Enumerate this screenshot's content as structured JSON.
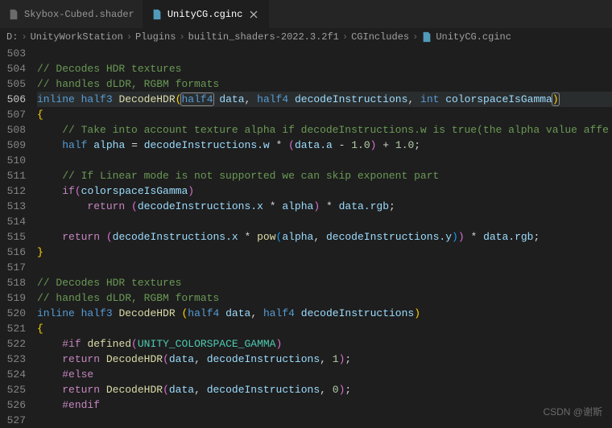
{
  "tabs": [
    {
      "label": "Skybox-Cubed.shader",
      "active": false
    },
    {
      "label": "UnityCG.cginc",
      "active": true
    }
  ],
  "breadcrumbs": [
    {
      "text": "D:"
    },
    {
      "text": "UnityWorkStation"
    },
    {
      "text": "Plugins"
    },
    {
      "text": "builtin_shaders-2022.3.2f1"
    },
    {
      "text": "CGIncludes"
    },
    {
      "text": "UnityCG.cginc"
    }
  ],
  "line_start": 503,
  "line_end": 527,
  "highlighted_line": 506,
  "code": {
    "l503": "",
    "l504": "// Decodes HDR textures",
    "l505": "// handles dLDR, RGBM formats",
    "l506_kw": "inline",
    "l506_type1": "half3",
    "l506_fn": "DecodeHDR",
    "l506_type2": "half4",
    "l506_p1": "data",
    "l506_type3": "half4",
    "l506_p2": "decodeInstructions",
    "l506_type4": "int",
    "l506_p3": "colorspaceIsGamma",
    "l508": "// Take into account texture alpha if decodeInstructions.w is true(the alpha value affe",
    "l509_type": "half",
    "l509_var": "alpha",
    "l509_expr1": "decodeInstructions.w",
    "l509_expr2": "data.a",
    "l509_n1": "1.0",
    "l509_n2": "1.0",
    "l511": "// If Linear mode is not supported we can skip exponent part",
    "l512_kw": "if",
    "l512_cond": "colorspaceIsGamma",
    "l513_kw": "return",
    "l513_a": "decodeInstructions.x",
    "l513_b": "alpha",
    "l513_c": "data.rgb",
    "l515_kw": "return",
    "l515_a": "decodeInstructions.x",
    "l515_fn": "pow",
    "l515_b": "alpha",
    "l515_c": "decodeInstructions.y",
    "l515_d": "data.rgb",
    "l518": "// Decodes HDR textures",
    "l519": "// handles dLDR, RGBM formats",
    "l520_kw": "inline",
    "l520_type1": "half3",
    "l520_fn": "DecodeHDR",
    "l520_type2": "half4",
    "l520_p1": "data",
    "l520_type3": "half4",
    "l520_p2": "decodeInstructions",
    "l522_if": "#if",
    "l522_def": "defined",
    "l522_sym": "UNITY_COLORSPACE_GAMMA",
    "l523_kw": "return",
    "l523_fn": "DecodeHDR",
    "l523_a": "data",
    "l523_b": "decodeInstructions",
    "l523_n": "1",
    "l524": "#else",
    "l525_kw": "return",
    "l525_fn": "DecodeHDR",
    "l525_a": "data",
    "l525_b": "decodeInstructions",
    "l525_n": "0",
    "l526": "#endif"
  },
  "watermark": "CSDN @谢斯"
}
